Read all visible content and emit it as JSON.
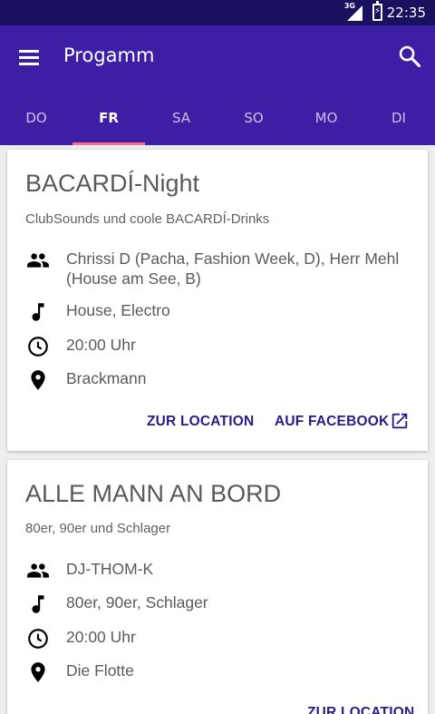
{
  "status_bar": {
    "network": "3G",
    "time": "22:35"
  },
  "app_bar": {
    "title": "Progamm"
  },
  "tabs": [
    {
      "label": "DO",
      "active": false
    },
    {
      "label": "FR",
      "active": true
    },
    {
      "label": "SA",
      "active": false
    },
    {
      "label": "SO",
      "active": false
    },
    {
      "label": "MO",
      "active": false
    },
    {
      "label": "DI",
      "active": false
    }
  ],
  "events": [
    {
      "title": "BACARDÍ-Night",
      "subtitle": "ClubSounds und coole BACARDÍ-Drinks",
      "artists": "Chrissi D (Pacha, Fashion Week, D), Herr Mehl (House am See, B)",
      "genre": "House, Electro",
      "time": "20:00 Uhr",
      "location": "Brackmann",
      "location_button": "ZUR LOCATION",
      "facebook_button": "AUF FACEBOOK"
    },
    {
      "title": "ALLE MANN AN BORD",
      "subtitle": "80er, 90er und Schlager",
      "artists": "DJ-THOM-K",
      "genre": "80er, 90er, Schlager",
      "time": "20:00 Uhr",
      "location": "Die Flotte",
      "location_button": "ZUR LOCATION"
    }
  ],
  "colors": {
    "primary": "#3d1fa6",
    "status_bar": "#1a1060",
    "tab_indicator": "#ff6f8b",
    "action": "#2c1a86"
  }
}
